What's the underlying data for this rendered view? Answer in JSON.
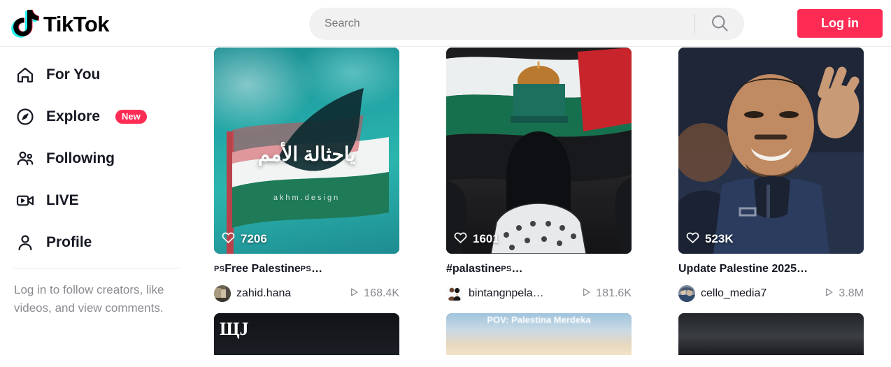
{
  "brand": {
    "name": "TikTok",
    "accent": "#fe2c55"
  },
  "header": {
    "search": {
      "placeholder": "Search",
      "value": "",
      "icon": "search-icon"
    },
    "login_label": "Log in"
  },
  "sidebar": {
    "items": [
      {
        "label": "For You",
        "icon": "home-icon",
        "badge": null
      },
      {
        "label": "Explore",
        "icon": "compass-icon",
        "badge": "New"
      },
      {
        "label": "Following",
        "icon": "people-icon",
        "badge": null
      },
      {
        "label": "LIVE",
        "icon": "live-video-icon",
        "badge": null
      },
      {
        "label": "Profile",
        "icon": "person-icon",
        "badge": null
      }
    ],
    "note": "Log in to follow creators, like videos, and view comments."
  },
  "feed": {
    "videos": [
      {
        "likes": "7206",
        "caption_prefix": "PS",
        "caption_main": "Free Palestine",
        "caption_suffix": "PS",
        "caption_ellipsis": "…",
        "author": "zahid.hana",
        "views": "168.4K",
        "overlay_text": "ياحثالة الأمم",
        "watermark": "akhm.design",
        "art": "art-flag-sky"
      },
      {
        "likes": "1601",
        "caption_prefix": "",
        "caption_main": "#palastine",
        "caption_suffix": "PS",
        "caption_ellipsis": "…",
        "author": "bintangnpela…",
        "views": "181.6K",
        "overlay_text": "",
        "watermark": "",
        "art": "art-dome"
      },
      {
        "likes": "523K",
        "caption_prefix": "",
        "caption_main": "Update Palestine 2025",
        "caption_suffix": "",
        "caption_ellipsis": "…",
        "author": "cello_media7",
        "views": "3.8M",
        "overlay_text": "",
        "watermark": "",
        "art": "art-press"
      }
    ],
    "next_row": [
      {
        "art": "art-dark-text",
        "glyph": "ЩJ",
        "text": ""
      },
      {
        "art": "art-sky-clouds",
        "glyph": "",
        "text": "POV: Palestina Merdeka"
      },
      {
        "art": "art-dark-grain",
        "glyph": "",
        "text": ""
      }
    ]
  }
}
